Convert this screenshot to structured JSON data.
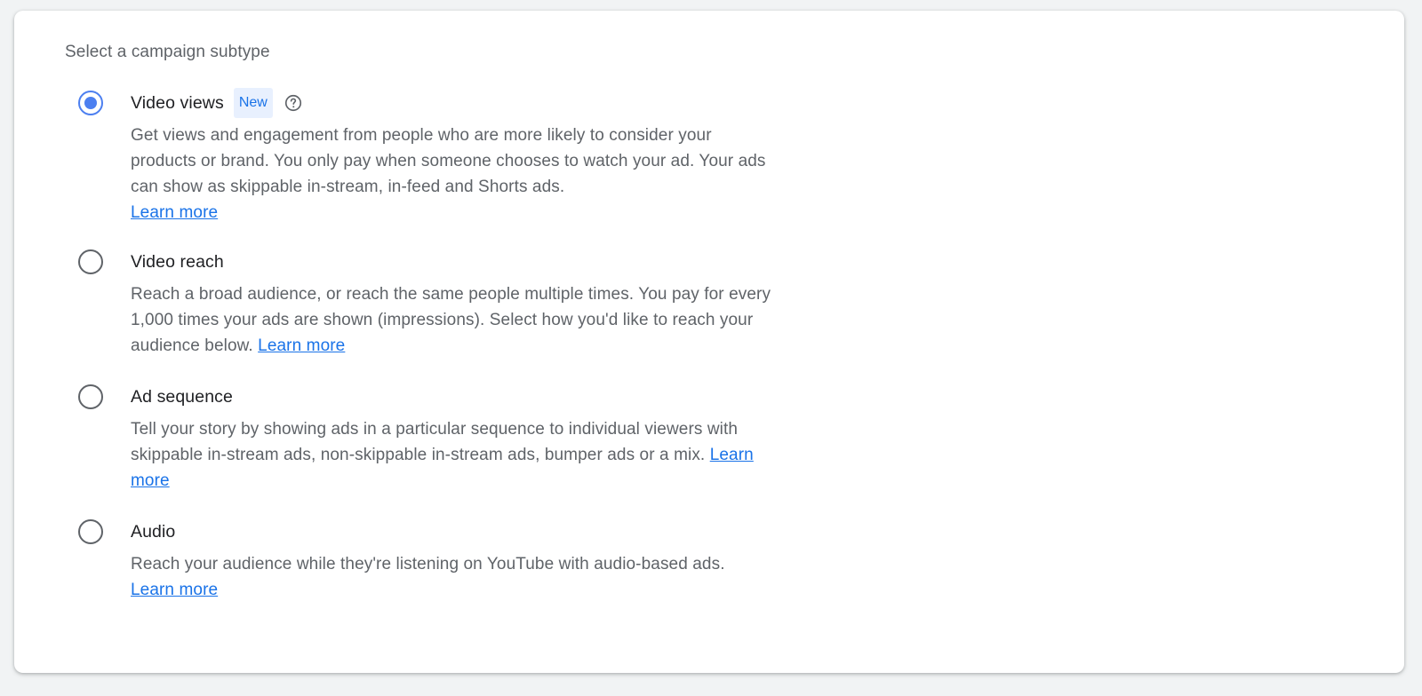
{
  "section_title": "Select a campaign subtype",
  "options": [
    {
      "label": "Video views",
      "badge": "New",
      "help_icon": "help-circle-icon",
      "selected": true,
      "description": "Get views and engagement from people who are more likely to consider your products or brand. You only pay when someone chooses to watch your ad. Your ads can show as skippable in-stream, in-feed and Shorts ads.",
      "learn_more": "Learn more"
    },
    {
      "label": "Video reach",
      "selected": false,
      "description": "Reach a broad audience, or reach the same people multiple times. You pay for every 1,000 times your ads are shown (impressions). Select how you'd like to reach your audience below.",
      "learn_more": "Learn more"
    },
    {
      "label": "Ad sequence",
      "selected": false,
      "description": "Tell your story by showing ads in a particular sequence to individual viewers with skippable in-stream ads, non-skippable in-stream ads, bumper ads or a mix.",
      "learn_more": "Learn more"
    },
    {
      "label": "Audio",
      "selected": false,
      "description": "Reach your audience while they're listening on YouTube with audio-based ads.",
      "learn_more": "Learn more"
    }
  ],
  "colors": {
    "accent": "#4c7ff0",
    "link": "#1a73e8",
    "badge_bg": "#e8f0fe",
    "text_primary": "#202124",
    "text_secondary": "#5f6368"
  }
}
